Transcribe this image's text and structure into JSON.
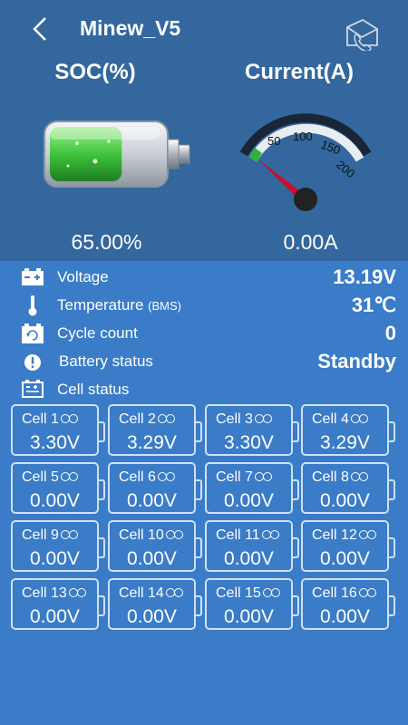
{
  "header": {
    "title": "Minew_V5",
    "back_icon": "chevron-left-icon",
    "share_icon": "envelope-phone-icon"
  },
  "soc": {
    "label": "SOC(%)",
    "value": "65.00%",
    "level": 0.65
  },
  "current": {
    "label": "Current(A)",
    "value": "0.00A",
    "gauge_ticks": [
      "50",
      "100",
      "150",
      "200"
    ]
  },
  "info": [
    {
      "icon": "battery-icon",
      "label": "Voltage",
      "label_small": "",
      "value": "13.19V"
    },
    {
      "icon": "thermometer-icon",
      "label": "Temperature ",
      "label_small": "(BMS)",
      "value": "31℃"
    },
    {
      "icon": "cycle-battery-icon",
      "label": "Cycle count",
      "label_small": "",
      "value": "0"
    },
    {
      "icon": "alert-icon",
      "label": "Battery status",
      "label_small": "",
      "value": "Standby"
    },
    {
      "icon": "cell-status-icon",
      "label": "Cell status",
      "label_small": "",
      "value": ""
    }
  ],
  "cells": [
    {
      "name": "Cell 1",
      "value": "3.30V"
    },
    {
      "name": "Cell 2",
      "value": "3.29V"
    },
    {
      "name": "Cell 3",
      "value": "3.30V"
    },
    {
      "name": "Cell 4",
      "value": "3.29V"
    },
    {
      "name": "Cell 5",
      "value": "0.00V"
    },
    {
      "name": "Cell 6",
      "value": "0.00V"
    },
    {
      "name": "Cell 7",
      "value": "0.00V"
    },
    {
      "name": "Cell 8",
      "value": "0.00V"
    },
    {
      "name": "Cell 9",
      "value": "0.00V"
    },
    {
      "name": "Cell 10",
      "value": "0.00V"
    },
    {
      "name": "Cell 11",
      "value": "0.00V"
    },
    {
      "name": "Cell 12",
      "value": "0.00V"
    },
    {
      "name": "Cell 13",
      "value": "0.00V"
    },
    {
      "name": "Cell 14",
      "value": "0.00V"
    },
    {
      "name": "Cell 15",
      "value": "0.00V"
    },
    {
      "name": "Cell 16",
      "value": "0.00V"
    }
  ],
  "colors": {
    "header_bg": "#33679e",
    "body_bg": "#3a7cc8",
    "battery_green": "#3fc43c",
    "needle_red": "#c8102e"
  }
}
